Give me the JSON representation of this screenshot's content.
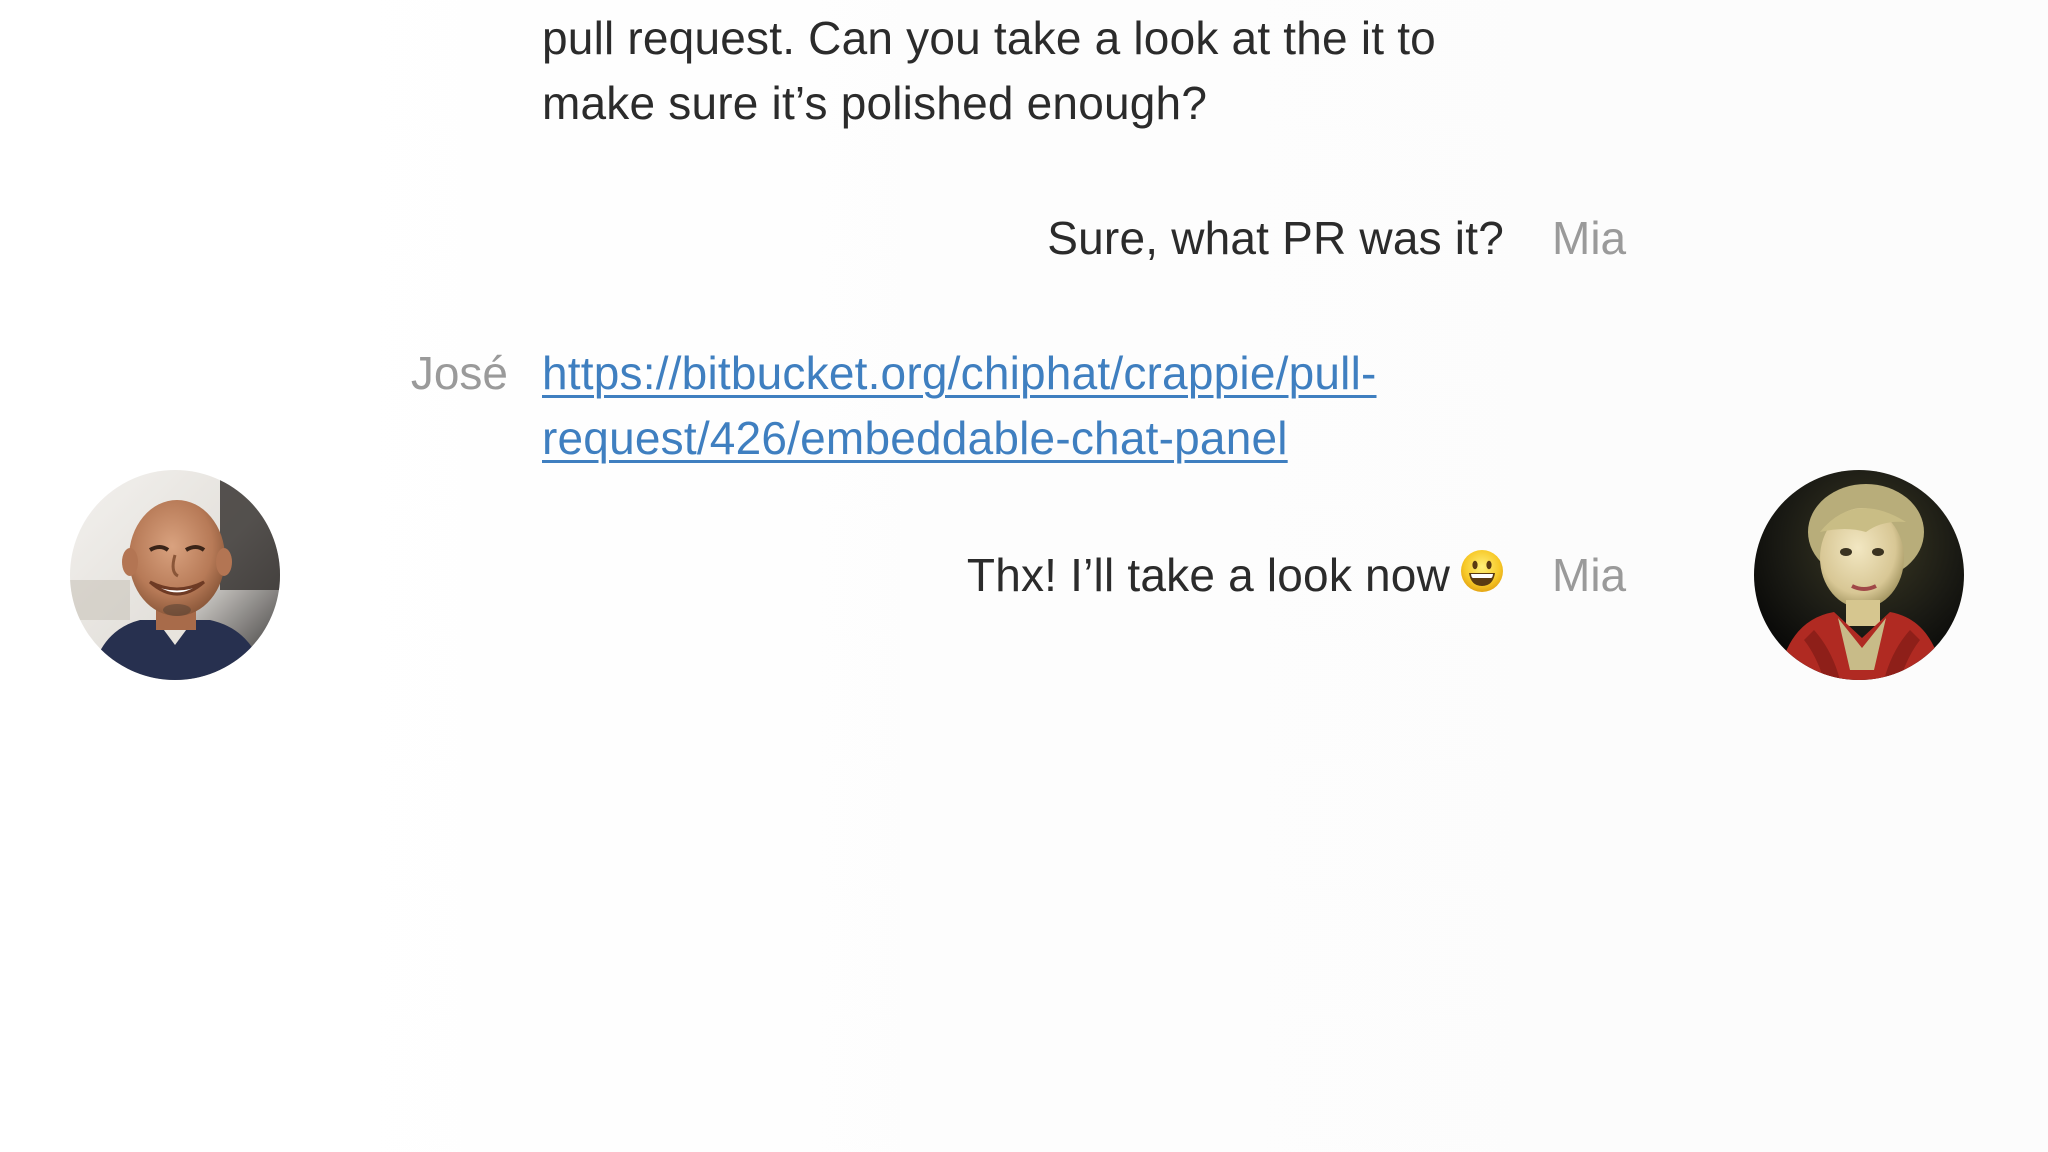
{
  "conversation": {
    "messages": [
      {
        "sender": "",
        "lines": [
          "pull request. Can you take a look at the it to",
          "make sure it’s polished enough?"
        ]
      },
      {
        "sender": "Mia",
        "text": "Sure, what PR was it?"
      },
      {
        "sender": "José",
        "link_lines": [
          "https://bitbucket.org/chiphat/crappie/pull-",
          "request/426/embeddable-chat-panel"
        ]
      },
      {
        "sender": "Mia",
        "text": "Thx! I’ll take a look now",
        "emoji": "grinning-face-emoji"
      }
    ]
  },
  "participants": {
    "left": {
      "name": "José",
      "avatar_icon": "man-smiling-avatar"
    },
    "right": {
      "name": "Mia",
      "avatar_icon": "woman-portrait-avatar"
    }
  },
  "colors": {
    "message_text": "#2b2b2b",
    "sender_name": "#9a9a9a",
    "link": "#3f7fc0"
  }
}
